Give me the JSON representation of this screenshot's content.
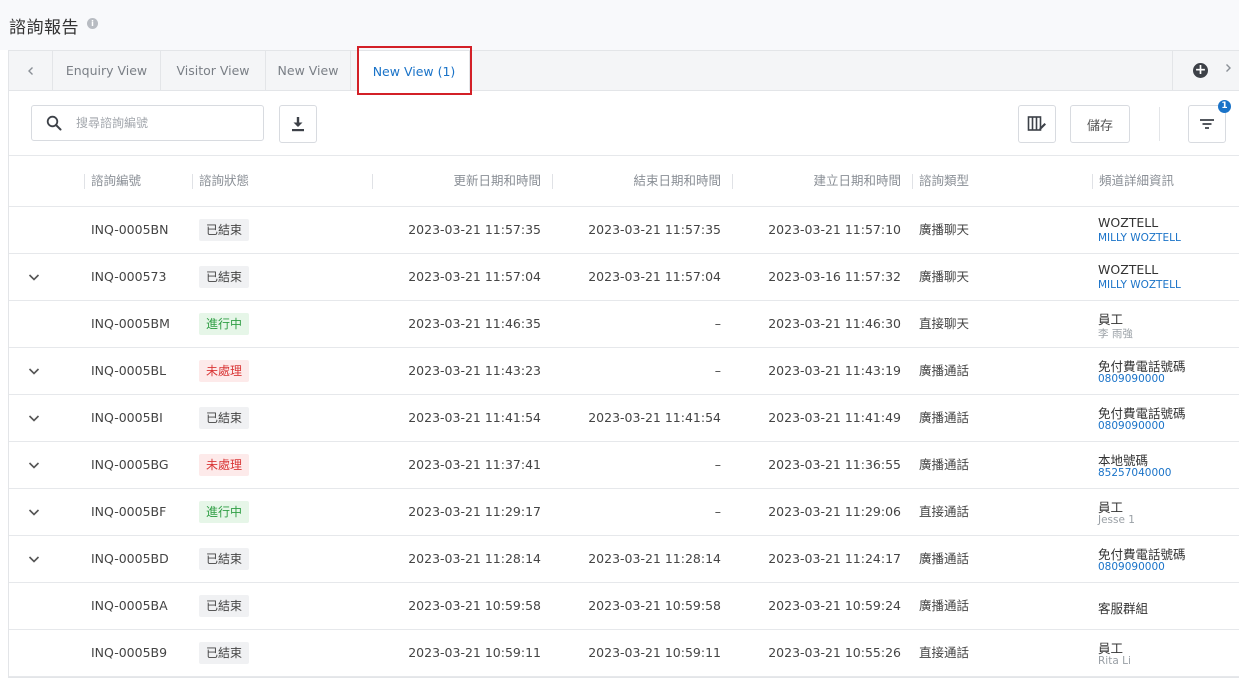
{
  "page": {
    "title": "諮詢報告"
  },
  "tabs": [
    {
      "label": "Enquiry View"
    },
    {
      "label": "Visitor View"
    },
    {
      "label": "New View"
    },
    {
      "label": "New View (1)"
    }
  ],
  "toolbar": {
    "search_placeholder": "搜尋諮詢編號",
    "save_label": "儲存",
    "filter_count": "1"
  },
  "table": {
    "columns": [
      "諮詢編號",
      "諮詢狀態",
      "更新日期和時間",
      "結束日期和時間",
      "建立日期和時間",
      "諮詢類型",
      "頻道詳細資訊"
    ],
    "rows": [
      {
        "expandable": false,
        "id": "INQ-0005BN",
        "status": "已結束",
        "status_kind": "closed",
        "updated": "2023-03-21 11:57:35",
        "ended": "2023-03-21 11:57:35",
        "created": "2023-03-21 11:57:10",
        "type": "廣播聊天",
        "channel": "WOZTELL",
        "channel_sub": "MILLY WOZTELL",
        "sub_style": "link"
      },
      {
        "expandable": true,
        "id": "INQ-000573",
        "status": "已結束",
        "status_kind": "closed",
        "updated": "2023-03-21 11:57:04",
        "ended": "2023-03-21 11:57:04",
        "created": "2023-03-16 11:57:32",
        "type": "廣播聊天",
        "channel": "WOZTELL",
        "channel_sub": "MILLY WOZTELL",
        "sub_style": "link"
      },
      {
        "expandable": false,
        "id": "INQ-0005BM",
        "status": "進行中",
        "status_kind": "active",
        "updated": "2023-03-21 11:46:35",
        "ended": "–",
        "created": "2023-03-21 11:46:30",
        "type": "直接聊天",
        "channel": "員工",
        "channel_sub": "李 雨強",
        "sub_style": "muted"
      },
      {
        "expandable": true,
        "id": "INQ-0005BL",
        "status": "未處理",
        "status_kind": "pending",
        "updated": "2023-03-21 11:43:23",
        "ended": "–",
        "created": "2023-03-21 11:43:19",
        "type": "廣播通話",
        "channel": "免付費電話號碼",
        "channel_sub": "0809090000",
        "sub_style": "link"
      },
      {
        "expandable": true,
        "id": "INQ-0005BI",
        "status": "已結束",
        "status_kind": "closed",
        "updated": "2023-03-21 11:41:54",
        "ended": "2023-03-21 11:41:54",
        "created": "2023-03-21 11:41:49",
        "type": "廣播通話",
        "channel": "免付費電話號碼",
        "channel_sub": "0809090000",
        "sub_style": "link"
      },
      {
        "expandable": true,
        "id": "INQ-0005BG",
        "status": "未處理",
        "status_kind": "pending",
        "updated": "2023-03-21 11:37:41",
        "ended": "–",
        "created": "2023-03-21 11:36:55",
        "type": "廣播通話",
        "channel": "本地號碼",
        "channel_sub": "85257040000",
        "sub_style": "link"
      },
      {
        "expandable": true,
        "id": "INQ-0005BF",
        "status": "進行中",
        "status_kind": "active",
        "updated": "2023-03-21 11:29:17",
        "ended": "–",
        "created": "2023-03-21 11:29:06",
        "type": "直接通話",
        "channel": "員工",
        "channel_sub": "Jesse 1",
        "sub_style": "muted"
      },
      {
        "expandable": true,
        "id": "INQ-0005BD",
        "status": "已結束",
        "status_kind": "closed",
        "updated": "2023-03-21 11:28:14",
        "ended": "2023-03-21 11:28:14",
        "created": "2023-03-21 11:24:17",
        "type": "廣播通話",
        "channel": "免付費電話號碼",
        "channel_sub": "0809090000",
        "sub_style": "link"
      },
      {
        "expandable": false,
        "id": "INQ-0005BA",
        "status": "已結束",
        "status_kind": "closed",
        "updated": "2023-03-21 10:59:58",
        "ended": "2023-03-21 10:59:58",
        "created": "2023-03-21 10:59:24",
        "type": "廣播通話",
        "channel": "客服群組",
        "channel_sub": "",
        "sub_style": "none"
      },
      {
        "expandable": false,
        "id": "INQ-0005B9",
        "status": "已結束",
        "status_kind": "closed",
        "updated": "2023-03-21 10:59:11",
        "ended": "2023-03-21 10:59:11",
        "created": "2023-03-21 10:55:26",
        "type": "直接通話",
        "channel": "員工",
        "channel_sub": "Rita Li",
        "sub_style": "muted"
      }
    ]
  }
}
